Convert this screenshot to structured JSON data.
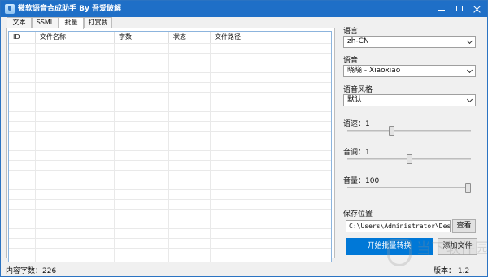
{
  "window": {
    "title": "微软语音合成助手 By 吾爱破解"
  },
  "tabs": [
    {
      "label": "文本"
    },
    {
      "label": "SSML"
    },
    {
      "label": "批量",
      "active": true
    },
    {
      "label": "打赏我"
    }
  ],
  "table": {
    "columns": [
      "ID",
      "文件名称",
      "字数",
      "状态",
      "文件路径"
    ]
  },
  "settings": {
    "language": {
      "label": "语言",
      "value": "zh-CN"
    },
    "voice": {
      "label": "语音",
      "value": "晓晓 - Xiaoxiao"
    },
    "style": {
      "label": "语音风格",
      "value": "默认"
    },
    "rate": {
      "label": "语速：1",
      "level": 0.35
    },
    "pitch": {
      "label": "音调：1",
      "level": 0.5
    },
    "volume": {
      "label": "音量：100",
      "level": 1.0
    }
  },
  "save": {
    "label": "保存位置",
    "path": "C:\\Users\\Administrator\\Deskt...",
    "browse_label": "查看"
  },
  "actions": {
    "start_label": "开始批量转换",
    "add_label": "添加文件"
  },
  "status": {
    "count_text": "内容字数：226",
    "version_text": "版本： 1.2"
  },
  "watermark_text": "当下软件园",
  "colors": {
    "accent": "#0078d7",
    "titlebar": "#1f6fc7"
  }
}
